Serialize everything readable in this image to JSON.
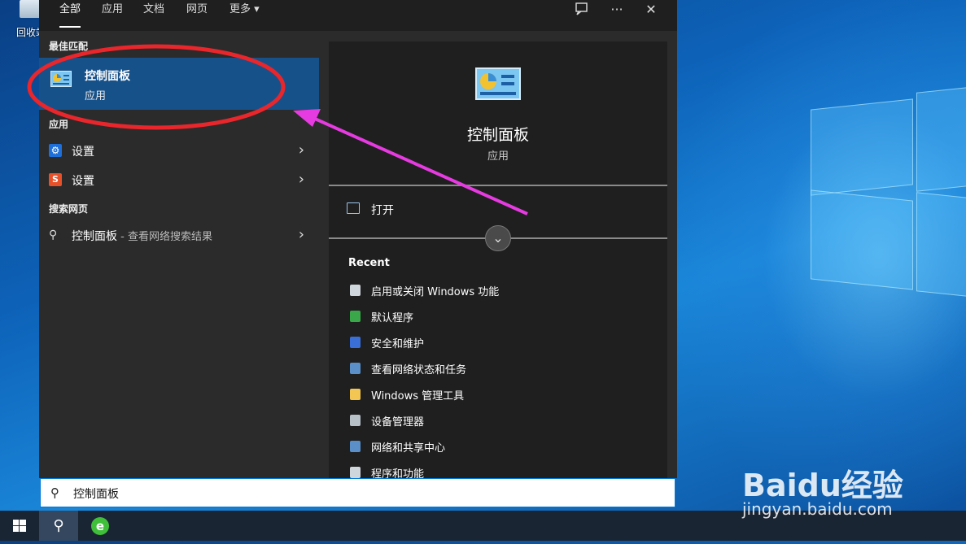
{
  "desktop": {
    "recycle_bin_label": "回收站"
  },
  "tabs": [
    {
      "label": "全部",
      "active": true
    },
    {
      "label": "应用"
    },
    {
      "label": "文档"
    },
    {
      "label": "网页"
    },
    {
      "label": "更多 ▾"
    }
  ],
  "top_icons": {
    "feedback": "feedback-icon",
    "more": "···",
    "close": "✕"
  },
  "results": {
    "best_match_header": "最佳匹配",
    "best_match": {
      "title": "控制面板",
      "subtitle": "应用"
    },
    "apps_header": "应用",
    "apps": [
      {
        "label": "设置",
        "icon_color": "#1e6fd9"
      },
      {
        "label": "设置",
        "icon_color": "#e8502a"
      }
    ],
    "web_header": "搜索网页",
    "web": {
      "label": "控制面板",
      "suffix": " - 查看网络搜索结果"
    }
  },
  "detail": {
    "title": "控制面板",
    "subtitle": "应用",
    "open_label": "打开",
    "recent_header": "Recent",
    "recent": [
      "启用或关闭 Windows 功能",
      "默认程序",
      "安全和维护",
      "查看网络状态和任务",
      "Windows 管理工具",
      "设备管理器",
      "网络和共享中心",
      "程序和功能"
    ]
  },
  "search": {
    "value": "控制面板"
  },
  "watermark": {
    "brand": "Baidu经验",
    "url": "jingyan.baidu.com"
  },
  "colors": {
    "highlight": "#17518a",
    "annotation": "#e8262b",
    "arrow": "#e63be0"
  }
}
